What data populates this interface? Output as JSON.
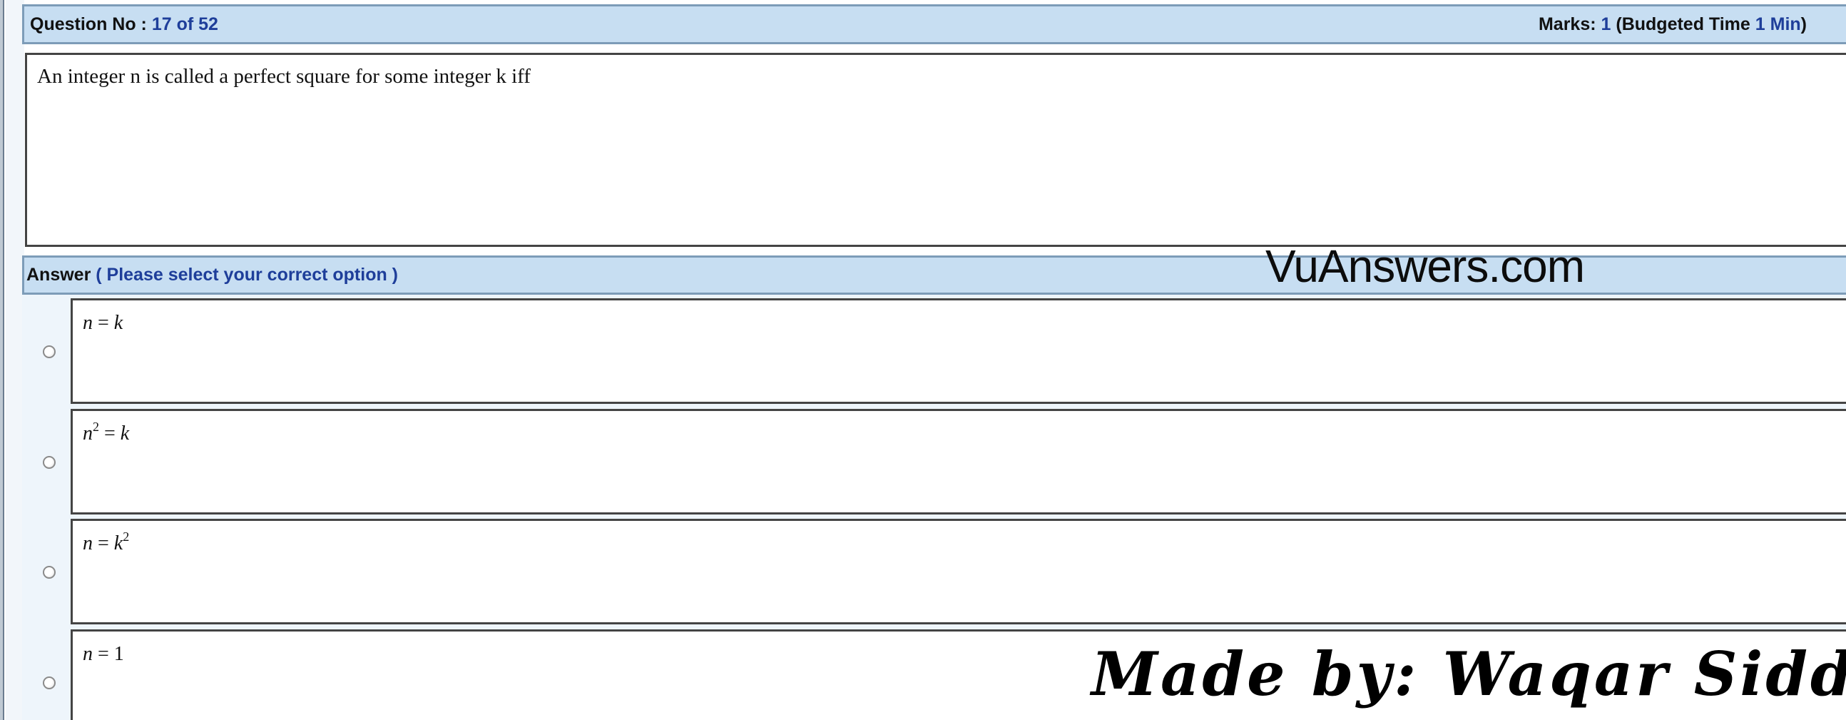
{
  "question_header": {
    "label": "Question No : ",
    "number": "17 of 52",
    "marks_label": "Marks: ",
    "marks_value": "1",
    "budget_label": "(Budgeted Time ",
    "budget_value": "1 Min",
    "budget_close": ")"
  },
  "question": {
    "text": "An integer n is called a perfect square for some integer k iff"
  },
  "answer_header": {
    "label": "Answer",
    "hint": "( Please select your correct option )"
  },
  "watermarks": {
    "site": "VuAnswers.com",
    "author": "Made by: Waqar Siddhu"
  },
  "options": [
    {
      "lhs": "n",
      "lhs_sup": "",
      "op": " = ",
      "rhs": "k",
      "rhs_sup": "",
      "selected": false
    },
    {
      "lhs": "n",
      "lhs_sup": "2",
      "op": " = ",
      "rhs": "k",
      "rhs_sup": "",
      "selected": false
    },
    {
      "lhs": "n",
      "lhs_sup": "",
      "op": " = ",
      "rhs": "k",
      "rhs_sup": "2",
      "selected": false
    },
    {
      "lhs": "n",
      "lhs_sup": "",
      "op": " = ",
      "rhs": "1",
      "rhs_sup": "",
      "selected": false
    }
  ],
  "colors": {
    "header_bg": "#c7def2",
    "header_border": "#7d9cb8",
    "accent_text": "#1e3e9a",
    "options_bg": "#eef5fb"
  }
}
